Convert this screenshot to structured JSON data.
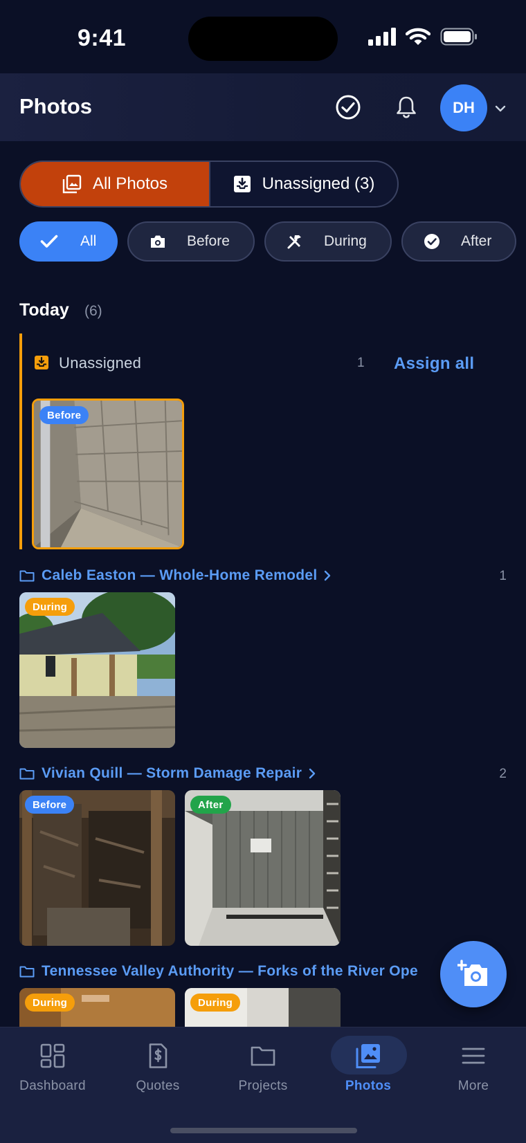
{
  "status_bar": {
    "time": "9:41"
  },
  "header": {
    "title": "Photos",
    "avatar_initials": "DH"
  },
  "segments": [
    {
      "label": "All Photos",
      "icon": "photo-library-icon",
      "active": true
    },
    {
      "label": "Unassigned (3)",
      "icon": "inbox-download-icon",
      "active": false
    }
  ],
  "filters": [
    {
      "label": "All",
      "icon": "check-icon",
      "active": true
    },
    {
      "label": "Before",
      "icon": "camera-icon",
      "active": false
    },
    {
      "label": "During",
      "icon": "tools-icon",
      "active": false
    },
    {
      "label": "After",
      "icon": "check-circle-icon",
      "active": false
    }
  ],
  "section": {
    "title": "Today",
    "count": "(6)"
  },
  "unassigned": {
    "label": "Unassigned",
    "count": "1",
    "action": "Assign all",
    "photos": [
      {
        "badge": "Before"
      }
    ]
  },
  "projects": [
    {
      "name": "Caleb Easton — Whole-Home Remodel",
      "count": "1",
      "photos": [
        {
          "badge": "During"
        }
      ]
    },
    {
      "name": "Vivian Quill — Storm Damage Repair",
      "count": "2",
      "photos": [
        {
          "badge": "Before"
        },
        {
          "badge": "After"
        }
      ]
    },
    {
      "name": "Tennessee Valley Authority — Forks of the River Ope",
      "count": "",
      "photos": [
        {
          "badge": "During"
        },
        {
          "badge": "During"
        }
      ]
    }
  ],
  "tabs": [
    {
      "label": "Dashboard",
      "icon": "dashboard-icon"
    },
    {
      "label": "Quotes",
      "icon": "quote-document-icon"
    },
    {
      "label": "Projects",
      "icon": "folder-icon"
    },
    {
      "label": "Photos",
      "icon": "photos-icon",
      "active": true
    },
    {
      "label": "More",
      "icon": "menu-icon"
    }
  ],
  "colors": {
    "accent": "#3b82f6",
    "segment_active": "#c2410c",
    "unassigned": "#f59e0b",
    "background": "#0b1026"
  }
}
